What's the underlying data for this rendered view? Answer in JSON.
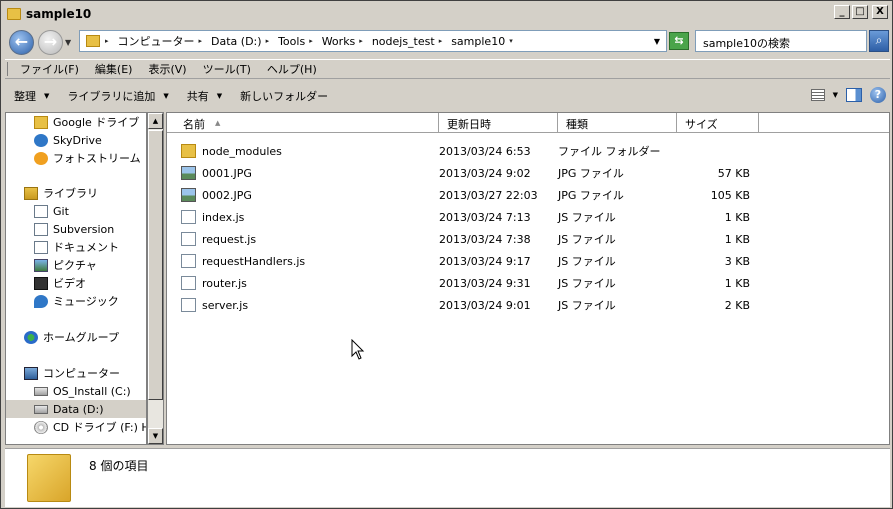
{
  "window": {
    "title": "sample10"
  },
  "title_buttons": {
    "minimize": "_",
    "maximize": "□",
    "close": "X"
  },
  "address": {
    "crumbs": [
      "コンピューター",
      "Data (D:)",
      "Tools",
      "Works",
      "nodejs_test",
      "sample10"
    ],
    "search_placeholder": "sample10の検索"
  },
  "menu": [
    "ファイル(F)",
    "編集(E)",
    "表示(V)",
    "ツール(T)",
    "ヘルプ(H)"
  ],
  "toolbar": {
    "organize": "整理",
    "include_library": "ライブラリに追加",
    "share": "共有",
    "new_folder": "新しいフォルダー"
  },
  "nav": {
    "favorites": [
      "Google ドライブ",
      "SkyDrive",
      "フォトストリーム"
    ],
    "library_label": "ライブラリ",
    "library_items": [
      "Git",
      "Subversion",
      "ドキュメント",
      "ピクチャ",
      "ビデオ",
      "ミュージック"
    ],
    "homegroup": "ホームグループ",
    "computer_label": "コンピューター",
    "drives": [
      "OS_Install (C:)",
      "Data (D:)",
      "CD ドライブ (F:) HD"
    ]
  },
  "columns": [
    "名前",
    "更新日時",
    "種類",
    "サイズ"
  ],
  "files": [
    {
      "name": "node_modules",
      "date": "2013/03/24 6:53",
      "type": "ファイル フォルダー",
      "size": "",
      "icon": "folder-icon"
    },
    {
      "name": "0001.JPG",
      "date": "2013/03/24 9:02",
      "type": "JPG ファイル",
      "size": "57 KB",
      "icon": "jpg-file-icon"
    },
    {
      "name": "0002.JPG",
      "date": "2013/03/27 22:03",
      "type": "JPG ファイル",
      "size": "105 KB",
      "icon": "jpg-file-icon"
    },
    {
      "name": "index.js",
      "date": "2013/03/24 7:13",
      "type": "JS ファイル",
      "size": "1 KB",
      "icon": "js-file-icon"
    },
    {
      "name": "request.js",
      "date": "2013/03/24 7:38",
      "type": "JS ファイル",
      "size": "1 KB",
      "icon": "js-file-icon"
    },
    {
      "name": "requestHandlers.js",
      "date": "2013/03/24 9:17",
      "type": "JS ファイル",
      "size": "3 KB",
      "icon": "js-file-icon"
    },
    {
      "name": "router.js",
      "date": "2013/03/24 9:31",
      "type": "JS ファイル",
      "size": "1 KB",
      "icon": "js-file-icon"
    },
    {
      "name": "server.js",
      "date": "2013/03/24 9:01",
      "type": "JS ファイル",
      "size": "2 KB",
      "icon": "js-file-icon"
    }
  ],
  "status": {
    "count": "8 個の項目"
  }
}
